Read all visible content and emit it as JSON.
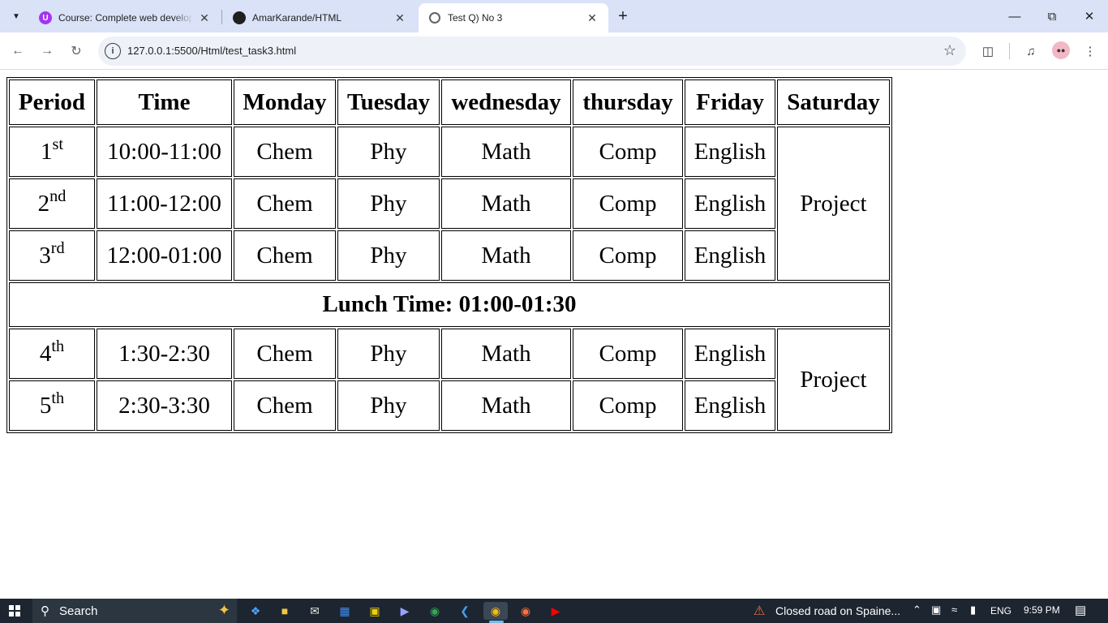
{
  "browser": {
    "tabs": [
      {
        "title": "Course: Complete web developm",
        "favicon": "udemy-icon",
        "active": false
      },
      {
        "title": "AmarKarande/HTML",
        "favicon": "github-icon",
        "active": false
      },
      {
        "title": "Test Q) No 3",
        "favicon": "globe-icon",
        "active": true
      }
    ],
    "url": "127.0.0.1:5500/Html/test_task3.html"
  },
  "timetable": {
    "headers": [
      "Period",
      "Time",
      "Monday",
      "Tuesday",
      "wednesday",
      "thursday",
      "Friday",
      "Saturday"
    ],
    "rows": [
      {
        "num": "1",
        "suffix": "st",
        "time": "10:00-11:00",
        "mon": "Chem",
        "tue": "Phy",
        "wed": "Math",
        "thu": "Comp",
        "fri": "English"
      },
      {
        "num": "2",
        "suffix": "nd",
        "time": "11:00-12:00",
        "mon": "Chem",
        "tue": "Phy",
        "wed": "Math",
        "thu": "Comp",
        "fri": "English"
      },
      {
        "num": "3",
        "suffix": "rd",
        "time": "12:00-01:00",
        "mon": "Chem",
        "tue": "Phy",
        "wed": "Math",
        "thu": "Comp",
        "fri": "English"
      },
      {
        "num": "4",
        "suffix": "th",
        "time": "1:30-2:30",
        "mon": "Chem",
        "tue": "Phy",
        "wed": "Math",
        "thu": "Comp",
        "fri": "English"
      },
      {
        "num": "5",
        "suffix": "th",
        "time": "2:30-3:30",
        "mon": "Chem",
        "tue": "Phy",
        "wed": "Math",
        "thu": "Comp",
        "fri": "English"
      }
    ],
    "saturday_block1": "Project",
    "saturday_block2": "Project",
    "lunch": "Lunch Time: 01:00-01:30"
  },
  "taskbar": {
    "search_label": "Search",
    "news": "Closed road on Spaine...",
    "language": "ENG",
    "time": "9:59 PM"
  }
}
